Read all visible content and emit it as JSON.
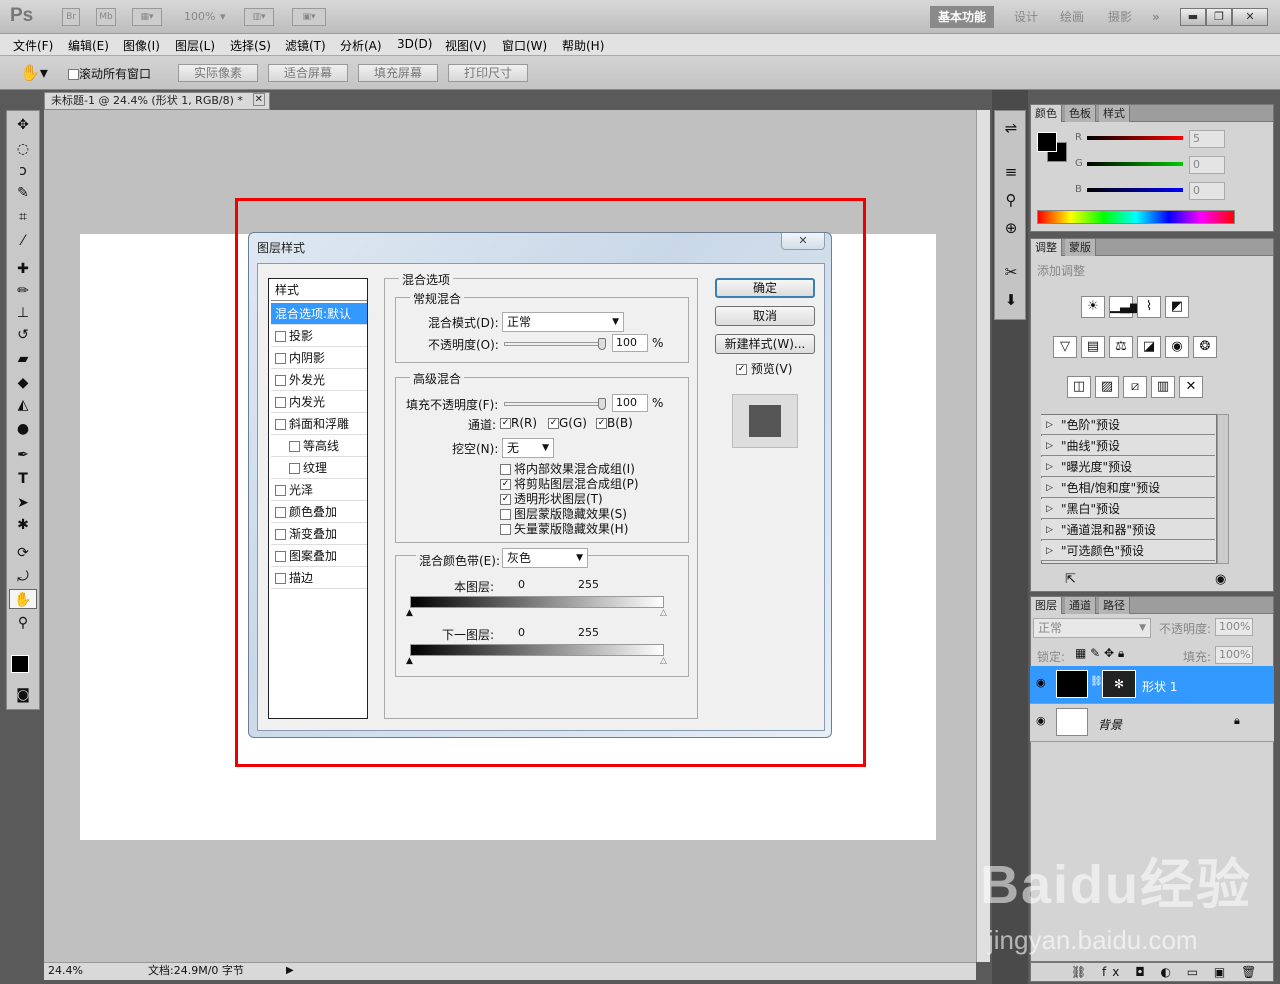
{
  "app": {
    "logo": "Ps",
    "bridge_btn": "Br",
    "mini_btn": "Mb",
    "zoom": "100%",
    "workspaces": [
      "基本功能",
      "设计",
      "绘画",
      "摄影"
    ],
    "more": "»"
  },
  "menus": [
    "文件(F)",
    "编辑(E)",
    "图像(I)",
    "图层(L)",
    "选择(S)",
    "滤镜(T)",
    "分析(A)",
    "3D(D)",
    "视图(V)",
    "窗口(W)",
    "帮助(H)"
  ],
  "options": {
    "scroll_all_label": "滚动所有窗口",
    "buttons": [
      "实际像素",
      "适合屏幕",
      "填充屏幕",
      "打印尺寸"
    ]
  },
  "document": {
    "tab_title": "未标题-1 @ 24.4% (形状 1, RGB/8) *",
    "zoom": "24.4%",
    "doc_info": "文档:24.9M/0 字节"
  },
  "dialog": {
    "title": "图层样式",
    "style_header": "样式",
    "styles": [
      {
        "label": "混合选项:默认",
        "selected": true,
        "checkbox": false
      },
      {
        "label": "投影",
        "checkbox": true
      },
      {
        "label": "内阴影",
        "checkbox": true
      },
      {
        "label": "外发光",
        "checkbox": true
      },
      {
        "label": "内发光",
        "checkbox": true
      },
      {
        "label": "斜面和浮雕",
        "checkbox": true
      },
      {
        "label": "等高线",
        "checkbox": true,
        "indent": true
      },
      {
        "label": "纹理",
        "checkbox": true,
        "indent": true
      },
      {
        "label": "光泽",
        "checkbox": true
      },
      {
        "label": "颜色叠加",
        "checkbox": true
      },
      {
        "label": "渐变叠加",
        "checkbox": true
      },
      {
        "label": "图案叠加",
        "checkbox": true
      },
      {
        "label": "描边",
        "checkbox": true
      }
    ],
    "blend_options_title": "混合选项",
    "general_title": "常规混合",
    "blend_mode_label": "混合模式(D):",
    "blend_mode_value": "正常",
    "opacity_label": "不透明度(O):",
    "opacity_value": "100",
    "opacity_fraction": 1.0,
    "percent": "%",
    "advanced_title": "高级混合",
    "fill_opacity_label": "填充不透明度(F):",
    "fill_opacity_value": "100",
    "channels_label": "通道:",
    "channel_r": "R(R)",
    "channel_g": "G(G)",
    "channel_b": "B(B)",
    "knockout_label": "挖空(N):",
    "knockout_value": "无",
    "adv_checks": [
      {
        "label": "将内部效果混合成组(I)",
        "checked": false
      },
      {
        "label": "将剪贴图层混合成组(P)",
        "checked": true
      },
      {
        "label": "透明形状图层(T)",
        "checked": true
      },
      {
        "label": "图层蒙版隐藏效果(S)",
        "checked": false
      },
      {
        "label": "矢量蒙版隐藏效果(H)",
        "checked": false
      }
    ],
    "blend_if_label": "混合颜色带(E):",
    "blend_if_value": "灰色",
    "this_layer_label": "本图层:",
    "underlying_label": "下一图层:",
    "range_min": "0",
    "range_max": "255",
    "ok": "确定",
    "cancel": "取消",
    "new_style": "新建样式(W)...",
    "preview": "预览(V)"
  },
  "color_panel": {
    "tabs": [
      "颜色",
      "色板",
      "样式"
    ],
    "r_label": "R",
    "g_label": "G",
    "b_label": "B",
    "r_value": "5",
    "g_value": "0",
    "b_value": "0"
  },
  "adjust_panel": {
    "tabs": [
      "调整",
      "蒙版"
    ],
    "title": "添加调整",
    "presets": [
      "\"色阶\"预设",
      "\"曲线\"预设",
      "\"曝光度\"预设",
      "\"色相/饱和度\"预设",
      "\"黑白\"预设",
      "\"通道混和器\"预设",
      "\"可选颜色\"预设"
    ]
  },
  "layers_panel": {
    "tabs": [
      "图层",
      "通道",
      "路径"
    ],
    "blend_mode": "正常",
    "opacity_label": "不透明度:",
    "opacity_value": "100%",
    "lock_label": "锁定:",
    "fill_label": "填充:",
    "fill_value": "100%",
    "layers": [
      {
        "name": "形状 1",
        "selected": true
      },
      {
        "name": "背景",
        "selected": false
      }
    ]
  },
  "watermark": {
    "text": "Baidu经验",
    "url": "jingyan.baidu.com"
  },
  "colors": {
    "selection": "#3399ff",
    "highlight_box": "#ee0000"
  }
}
